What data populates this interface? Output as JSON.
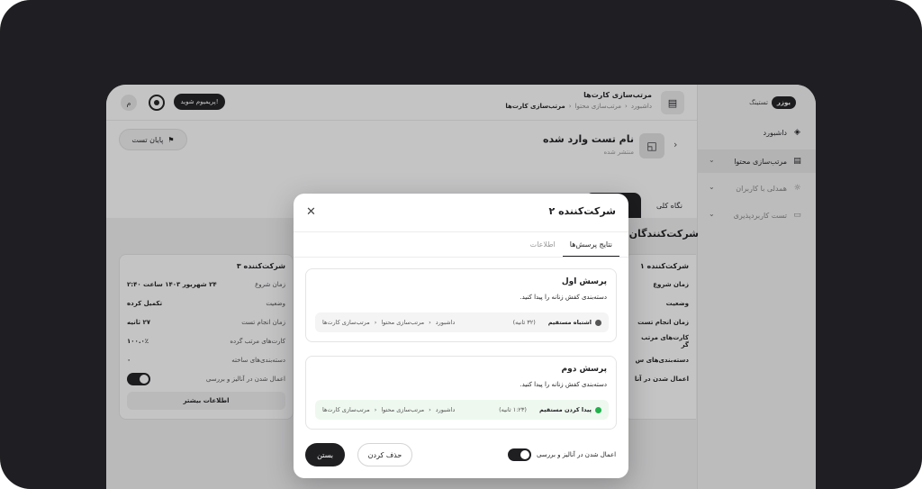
{
  "topbar": {
    "avatar": "م",
    "premium_label": "پریمیوم شوید!",
    "page_title": "مرتب‌سازی کارت‌ها",
    "breadcrumb": [
      "داشبورد",
      "مرتب‌سازی محتوا",
      "مرتب‌سازی کارت‌ها"
    ]
  },
  "sidebar": {
    "brand_pill": "یوزر",
    "brand_text": "تستینگ",
    "items": [
      {
        "label": "داشبورد"
      },
      {
        "label": "مرتب‌سازی محتوا"
      },
      {
        "label": "همدلی با کاربران"
      },
      {
        "label": "تست کاربردپذیری"
      }
    ]
  },
  "header": {
    "end_test_label": "پایان تست",
    "test_name": "نام تست وارد شده",
    "test_status": "منتشر شده"
  },
  "tabs": {
    "overview": "نگاه کلی",
    "other": "ش"
  },
  "content": {
    "section_title": "شرکت‌کنندگان",
    "card_left": {
      "title": "شرکت‌کننده ۳",
      "rows": [
        {
          "label": "زمان شروع",
          "value": "۲۴ شهریور ۱۴۰۳ ساعت ۲:۴۰"
        },
        {
          "label": "وضعیت",
          "value": "تکمیل کرده"
        },
        {
          "label": "زمان انجام تست",
          "value": "۲۷ ثانیه"
        },
        {
          "label": "کارت‌های مرتب گرده",
          "value": "۱۰۰.۰٪"
        },
        {
          "label": "دسته‌بندی‌های ساخته",
          "value": "۰"
        }
      ],
      "toggle_label": "اعمال شدن در آنالیز و بررسی",
      "more_label": "اطلاعات بیشتر"
    },
    "card_right": {
      "title": "شرکت‌کننده ۱",
      "rows": [
        "زمان شروع",
        "وضعیت",
        "زمان انجام تست",
        "کارت‌های مرتب گر",
        "دسته‌بندی‌های س",
        "اعمال شدن در آنا"
      ]
    }
  },
  "modal": {
    "title": "شرکت‌کننده ۲",
    "tabs": [
      "نتایج پرسش‌ها",
      "اطلاعات"
    ],
    "questions": [
      {
        "title": "پرسش اول",
        "text": "دسته‌بندی کفش زنانه را پیدا کنید.",
        "result": "اشتباه مستقیم",
        "result_color": "#555555",
        "time": "(۳۲ ثانیه)",
        "path": [
          "داشبورد",
          "مرتب‌سازی محتوا",
          "مرتب‌سازی کارت‌ها"
        ]
      },
      {
        "title": "پرسش دوم",
        "text": "دسته‌بندی کفش زنانه را پیدا کنید.",
        "result": "پیدا کردن مستقیم",
        "result_color": "#22b14c",
        "time": "(۱:۲۳ ثانیه)",
        "path": [
          "داشبورد",
          "مرتب‌سازی محتوا",
          "مرتب‌سازی کارت‌ها"
        ]
      }
    ],
    "toggle_label": "اعمال شدن در آنالیز و بررسی",
    "delete_label": "حذف کردن",
    "close_label": "بستن"
  }
}
